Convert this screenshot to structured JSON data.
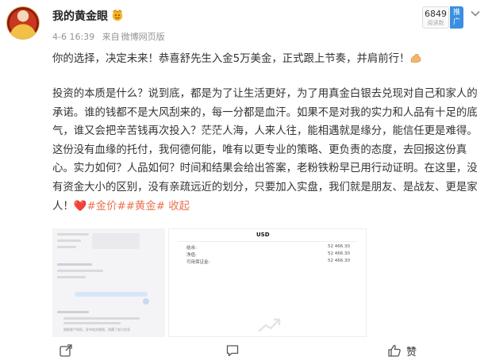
{
  "author": {
    "name": "我的黄金眼"
  },
  "meta": {
    "date": "4-6 16:39",
    "source_prefix": "来自",
    "source": "微博网页版"
  },
  "header": {
    "view_count": "6849",
    "view_label": "阅读数",
    "promote_label": "推广"
  },
  "post": {
    "line1": "你的选择，决定未来！恭喜舒先生入金5万美金，正式跟上节奏，并肩前行！",
    "body": "投资的本质是什么？说到底，都是为了让生活更好，为了用真金白银去兑现对自己和家人的承诺。谁的钱都不是大风刮来的，每一分都是血汗。如果不是对我的实力和人品有十足的底气，谁又会把辛苦钱再次投入？茫茫人海，人来人往，能相遇就是缘分，能信任更是难得。这份没有血缘的托付，我何德何能，唯有以更专业的策略、更负责的态度，去回报这份真心。实力如何？人品如何？时间和结果会给出答案，老粉铁粉早已用行动证明。在这里，没有资金大小的区别，没有亲疏远近的划分，只要加入实盘，我们就是朋友、是战友、更是家人！",
    "heart": "❤️",
    "topic1": "#金价#",
    "topic2": "#黄金#",
    "collapse": "收起"
  },
  "image2": {
    "currency": "USD",
    "rows": [
      {
        "label": "结余:",
        "value": "52 466.30"
      },
      {
        "label": "净值:",
        "value": "52 466.30"
      },
      {
        "label": "可用保证金:",
        "value": "52 466.30"
      }
    ]
  },
  "image1": {
    "footer_text": "根据客户授权，发布相关截图，隐藏了部分信息"
  },
  "actions": {
    "like_label": "赞"
  },
  "colors": {
    "topic": "#eb7350",
    "promo": "#3b8fe0",
    "text": "#333333",
    "muted": "#939393"
  }
}
